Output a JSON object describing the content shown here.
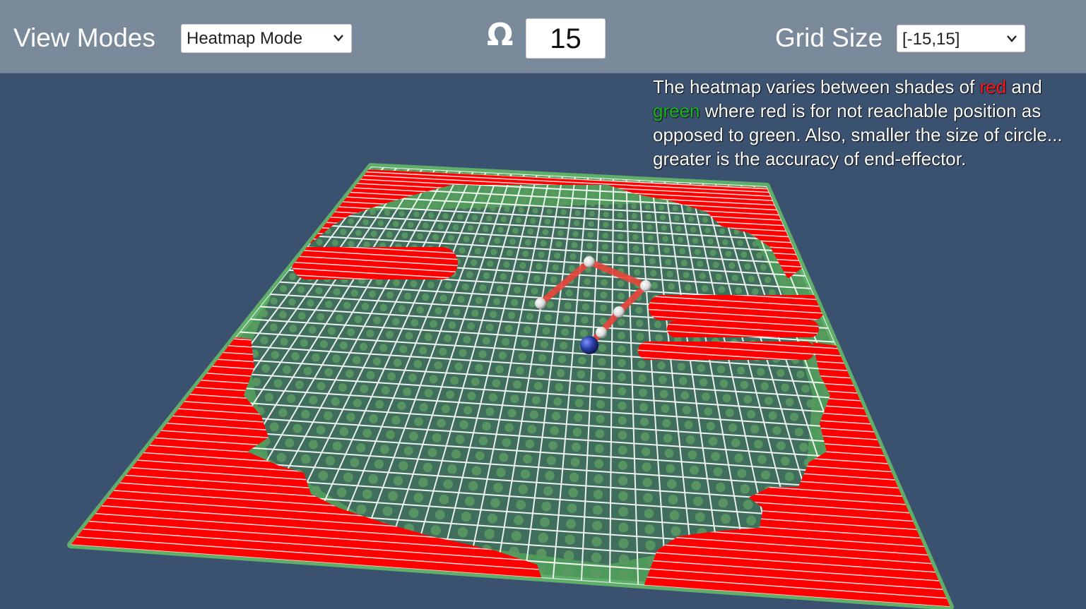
{
  "toolbar": {
    "view_modes_label": "View Modes",
    "view_mode_value": "Heatmap Mode",
    "omega_symbol": "Ω",
    "omega_value": "15",
    "grid_size_label": "Grid Size",
    "grid_size_value": "[-15,15]"
  },
  "info": {
    "part1": "The heatmap varies between shades of ",
    "red_word": "red",
    "part2": " and ",
    "green_word": "green",
    "part3": " where red is for not reachable position as opposed to green. Also, smaller the size of circle... greater is the accuracy of end-effector."
  },
  "colors": {
    "background": "#3a5170",
    "toolbar": "#7b8a9b",
    "unreachable": "#ff0000",
    "reachable": "#4e9a5a",
    "grid_line": "#ffffff",
    "arm_link": "#e8443a",
    "arm_base": "#1f2f8f"
  },
  "icons": {
    "dropdown": "chevron-down-icon"
  }
}
